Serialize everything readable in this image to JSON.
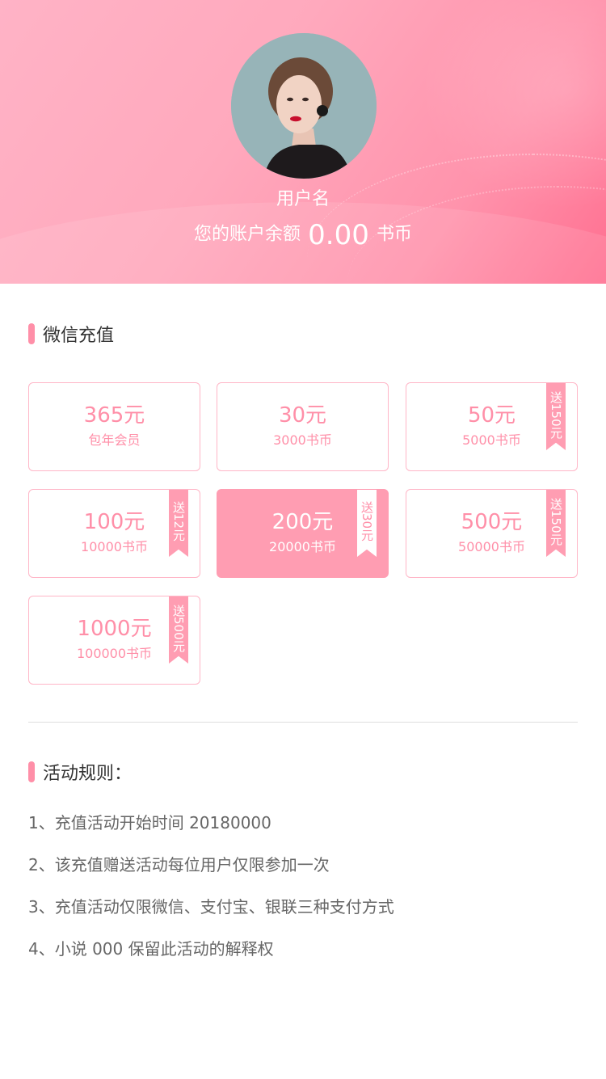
{
  "header": {
    "username": "用户名",
    "balance_label": "您的账户余额",
    "balance_amount": "0.00",
    "balance_unit": "书币"
  },
  "recharge": {
    "title": "微信充值",
    "items": [
      {
        "price": "365元",
        "desc": "包年会员",
        "bonus": ""
      },
      {
        "price": "30元",
        "desc": "3000书币",
        "bonus": ""
      },
      {
        "price": "50元",
        "desc": "5000书币",
        "bonus": "送150元"
      },
      {
        "price": "100元",
        "desc": "10000书币",
        "bonus": "送12元"
      },
      {
        "price": "200元",
        "desc": "20000书币",
        "bonus": "送30元"
      },
      {
        "price": "500元",
        "desc": "50000书币",
        "bonus": "送150元"
      },
      {
        "price": "1000元",
        "desc": "100000书币",
        "bonus": "送500元"
      }
    ],
    "selected_index": 4
  },
  "rules": {
    "title": "活动规则：",
    "items": [
      "1、充值活动开始时间 20180000",
      "2、该充值赠送活动每位用户仅限参加一次",
      "3、充值活动仅限微信、支付宝、银联三种支付方式",
      "4、小说 000 保留此活动的解释权"
    ]
  },
  "colors": {
    "accent": "#ff8fa8",
    "card_border": "#ffb6c7",
    "selected_card": "#ff9db2"
  }
}
